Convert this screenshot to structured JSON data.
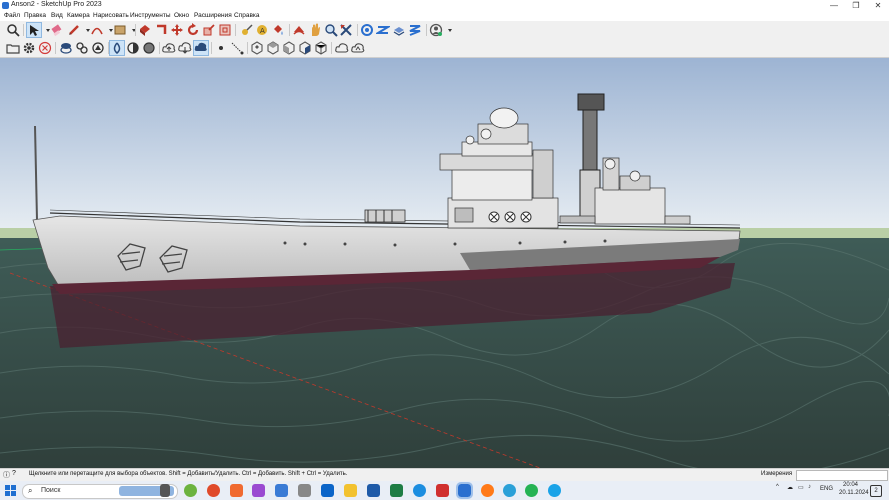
{
  "window": {
    "title": "Anson2 - SketchUp Pro 2023",
    "minimize_icon": "—",
    "maximize_icon": "❐",
    "close_icon": "✕"
  },
  "menu": [
    "Файл",
    "Правка",
    "Вид",
    "Камера",
    "Нарисовать",
    "Инструменты",
    "Окно",
    "Расширения",
    "Справка"
  ],
  "status": {
    "hint": "Щелкните или перетащите для выбора объектов. Shift = Добавить/Удалить. Ctrl = Добавить. Shift + Ctrl = Удалить.",
    "measure_label": "Измерения",
    "measure_value": ""
  },
  "taskbar": {
    "search_label": "Поиск",
    "lang": "ENG",
    "time": "20:04",
    "date": "20.11.2024",
    "notification_count": "2"
  },
  "colors": {
    "sky_top": "#9db4d3",
    "sky_bottom": "#e8eef3",
    "sea": "#3b4e49",
    "hull": "#d8d8d8",
    "boot_top": "#7b7b7b",
    "accent": "#2a6fcf"
  }
}
